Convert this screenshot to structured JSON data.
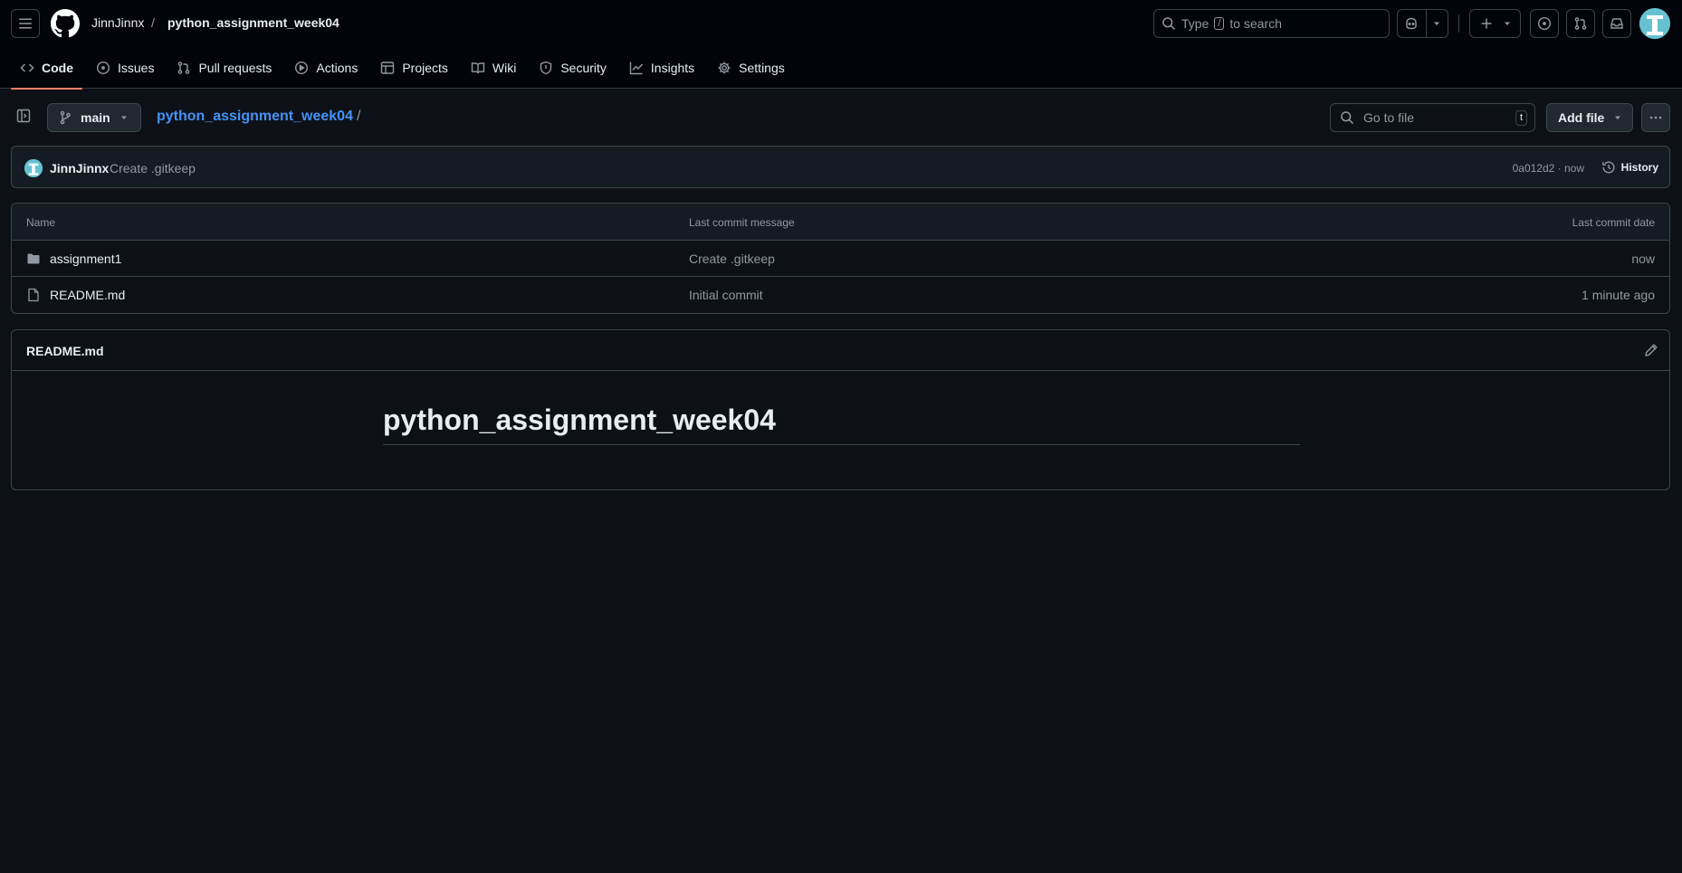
{
  "header": {
    "owner": "JinnJinnx",
    "separator": "/",
    "repo": "python_assignment_week04",
    "search": {
      "prefix": "Type",
      "key": "/",
      "suffix": "to search"
    }
  },
  "tabs": [
    {
      "label": "Code",
      "icon": "code-icon",
      "active": true
    },
    {
      "label": "Issues",
      "icon": "issue-icon"
    },
    {
      "label": "Pull requests",
      "icon": "pull-request-icon"
    },
    {
      "label": "Actions",
      "icon": "play-icon"
    },
    {
      "label": "Projects",
      "icon": "table-icon"
    },
    {
      "label": "Wiki",
      "icon": "book-icon"
    },
    {
      "label": "Security",
      "icon": "shield-icon"
    },
    {
      "label": "Insights",
      "icon": "graph-icon"
    },
    {
      "label": "Settings",
      "icon": "gear-icon"
    }
  ],
  "repo_bar": {
    "branch": "main",
    "path_repo": "python_assignment_week04",
    "path_sep": "/",
    "go_to_file": "Go to file",
    "go_to_file_key": "t",
    "add_file": "Add file"
  },
  "commit": {
    "author": "JinnJinnx",
    "message": "Create .gitkeep",
    "hash_time": "0a012d2 · now",
    "history": "History"
  },
  "files": {
    "headers": {
      "name": "Name",
      "message": "Last commit message",
      "date": "Last commit date"
    },
    "rows": [
      {
        "name": "assignment1",
        "type": "folder",
        "message": "Create .gitkeep",
        "date": "now"
      },
      {
        "name": "README.md",
        "type": "file",
        "message": "Initial commit",
        "date": "1 minute ago"
      }
    ]
  },
  "readme": {
    "filename": "README.md",
    "heading": "python_assignment_week04"
  },
  "colors": {
    "background": "#0d1117",
    "header_bg": "#010409",
    "accent_link": "#4493f8",
    "active_tab_underline": "#f78166",
    "border": "#3d444d"
  }
}
